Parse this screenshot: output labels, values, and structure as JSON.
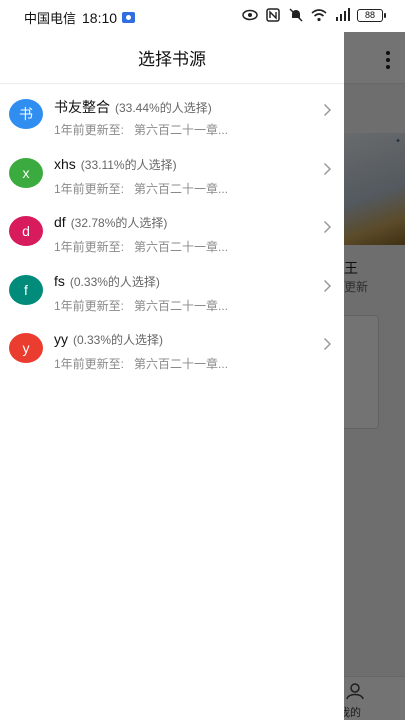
{
  "status_bar": {
    "carrier": "中国电信",
    "time": "18:10",
    "battery": "88"
  },
  "drawer": {
    "title": "选择书源",
    "items": [
      {
        "avatar": "书",
        "name": "书友整合",
        "percent": "(33.44%的人选择)",
        "updated": "1年前更新至:",
        "chapter": "第六百二十一章...",
        "color": "#2f8ef0"
      },
      {
        "avatar": "x",
        "name": "xhs",
        "percent": "(33.11%的人选择)",
        "updated": "1年前更新至:",
        "chapter": "第六百二十一章...",
        "color": "#3cab3f"
      },
      {
        "avatar": "d",
        "name": "df",
        "percent": "(32.78%的人选择)",
        "updated": "1年前更新至:",
        "chapter": "第六百二十一章...",
        "color": "#d81b5c"
      },
      {
        "avatar": "f",
        "name": "fs",
        "percent": "(0.33%的人选择)",
        "updated": "1年前更新至:",
        "chapter": "第六百二十一章...",
        "color": "#008b7a"
      },
      {
        "avatar": "y",
        "name": "yy",
        "percent": "(0.33%的人选择)",
        "updated": "1年前更新至:",
        "chapter": "第六百二十一章...",
        "color": "#ea3d2f"
      }
    ]
  },
  "background": {
    "book_title_fragment": "王",
    "book_sub_fragment": "更新",
    "tab_mine_fragment": "我的"
  }
}
